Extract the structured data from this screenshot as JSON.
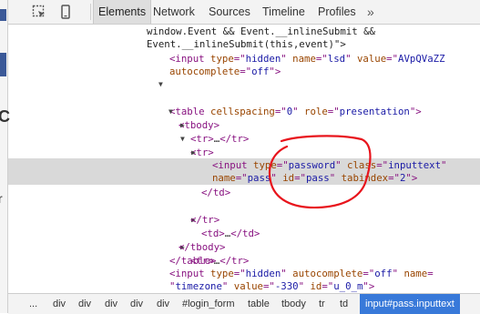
{
  "toolbar": {
    "inspect_icon": "inspect-element-icon",
    "device_icon": "device-mode-icon",
    "tabs": [
      {
        "label": "Elements"
      },
      {
        "label": "Network"
      },
      {
        "label": "Sources"
      },
      {
        "label": "Timeline"
      },
      {
        "label": "Profiles"
      }
    ],
    "more_label": "»"
  },
  "page_sliver": {
    "glyph_a": "C",
    "glyph_b": "r"
  },
  "dom_lines": [
    {
      "segments": [
        {
          "c": "plain",
          "t": "window.Event && Event.__inlineSubmit &&"
        }
      ]
    },
    {
      "segments": [
        {
          "c": "plain",
          "t": "Event.__inlineSubmit(this,event)\">"
        }
      ]
    },
    {
      "segments": [
        {
          "c": "tag",
          "t": "<input "
        },
        {
          "c": "attr",
          "t": "type"
        },
        {
          "c": "tag",
          "t": "=\""
        },
        {
          "c": "val",
          "t": "hidden"
        },
        {
          "c": "tag",
          "t": "\" "
        },
        {
          "c": "attr",
          "t": "name"
        },
        {
          "c": "tag",
          "t": "=\""
        },
        {
          "c": "val",
          "t": "lsd"
        },
        {
          "c": "tag",
          "t": "\" "
        },
        {
          "c": "attr",
          "t": "value"
        },
        {
          "c": "tag",
          "t": "=\""
        },
        {
          "c": "val",
          "t": "AVpQVaZZ"
        }
      ]
    },
    {
      "segments": [
        {
          "c": "attr",
          "t": "autocomplete"
        },
        {
          "c": "tag",
          "t": "=\""
        },
        {
          "c": "val",
          "t": "off"
        },
        {
          "c": "tag",
          "t": "\">"
        }
      ]
    },
    {
      "segments": [
        {
          "c": "tag",
          "t": "<table "
        },
        {
          "c": "attr",
          "t": "cellspacing"
        },
        {
          "c": "tag",
          "t": "=\""
        },
        {
          "c": "val",
          "t": "0"
        },
        {
          "c": "tag",
          "t": "\" "
        },
        {
          "c": "attr",
          "t": "role"
        },
        {
          "c": "tag",
          "t": "=\""
        },
        {
          "c": "val",
          "t": "presentation"
        },
        {
          "c": "tag",
          "t": "\">"
        }
      ]
    },
    {
      "segments": [
        {
          "c": "tag",
          "t": "<tbody>"
        }
      ]
    },
    {
      "segments": [
        {
          "c": "tag",
          "t": "<tr>"
        },
        {
          "c": "txt",
          "t": "…"
        },
        {
          "c": "tag",
          "t": "</tr>"
        }
      ]
    },
    {
      "segments": [
        {
          "c": "tag",
          "t": "<tr>"
        }
      ]
    },
    {
      "segments": [
        {
          "c": "tag",
          "t": "<td>"
        },
        {
          "c": "txt",
          "t": "…"
        },
        {
          "c": "tag",
          "t": "</td>"
        }
      ]
    },
    {
      "segments": [
        {
          "c": "tag",
          "t": "<td>"
        }
      ]
    },
    {
      "segments": [
        {
          "c": "tag",
          "t": "<input "
        },
        {
          "c": "attr",
          "t": "type"
        },
        {
          "c": "tag",
          "t": "=\""
        },
        {
          "c": "val",
          "t": "password"
        },
        {
          "c": "tag",
          "t": "\" "
        },
        {
          "c": "attr",
          "t": "class"
        },
        {
          "c": "tag",
          "t": "=\""
        },
        {
          "c": "val",
          "t": "inputtext"
        },
        {
          "c": "tag",
          "t": "\""
        }
      ]
    },
    {
      "segments": [
        {
          "c": "attr",
          "t": "name"
        },
        {
          "c": "tag",
          "t": "=\""
        },
        {
          "c": "val",
          "t": "pass"
        },
        {
          "c": "tag",
          "t": "\" "
        },
        {
          "c": "attr",
          "t": "id"
        },
        {
          "c": "tag",
          "t": "=\""
        },
        {
          "c": "val",
          "t": "pass"
        },
        {
          "c": "tag",
          "t": "\" "
        },
        {
          "c": "attr",
          "t": "tabindex"
        },
        {
          "c": "tag",
          "t": "=\""
        },
        {
          "c": "val",
          "t": "2"
        },
        {
          "c": "tag",
          "t": "\">"
        }
      ]
    },
    {
      "segments": [
        {
          "c": "tag",
          "t": "</td>"
        }
      ]
    },
    {
      "segments": [
        {
          "c": "tag",
          "t": "<td>"
        },
        {
          "c": "txt",
          "t": "…"
        },
        {
          "c": "tag",
          "t": "</td>"
        }
      ]
    },
    {
      "segments": [
        {
          "c": "tag",
          "t": "</tr>"
        }
      ]
    },
    {
      "segments": [
        {
          "c": "tag",
          "t": "<tr>"
        },
        {
          "c": "txt",
          "t": "…"
        },
        {
          "c": "tag",
          "t": "</tr>"
        }
      ]
    },
    {
      "segments": [
        {
          "c": "tag",
          "t": "</tbody>"
        }
      ]
    },
    {
      "segments": [
        {
          "c": "tag",
          "t": "</table>"
        }
      ]
    },
    {
      "segments": [
        {
          "c": "tag",
          "t": "<input "
        },
        {
          "c": "attr",
          "t": "type"
        },
        {
          "c": "tag",
          "t": "=\""
        },
        {
          "c": "val",
          "t": "hidden"
        },
        {
          "c": "tag",
          "t": "\" "
        },
        {
          "c": "attr",
          "t": "autocomplete"
        },
        {
          "c": "tag",
          "t": "=\""
        },
        {
          "c": "val",
          "t": "off"
        },
        {
          "c": "tag",
          "t": "\" "
        },
        {
          "c": "attr",
          "t": "name"
        },
        {
          "c": "tag",
          "t": "="
        }
      ]
    },
    {
      "segments": [
        {
          "c": "tag",
          "t": "\""
        },
        {
          "c": "val",
          "t": "timezone"
        },
        {
          "c": "tag",
          "t": "\" "
        },
        {
          "c": "attr",
          "t": "value"
        },
        {
          "c": "tag",
          "t": "=\""
        },
        {
          "c": "val",
          "t": "-330"
        },
        {
          "c": "tag",
          "t": "\" "
        },
        {
          "c": "attr",
          "t": "id"
        },
        {
          "c": "tag",
          "t": "=\""
        },
        {
          "c": "val",
          "t": "u_0_m"
        },
        {
          "c": "tag",
          "t": "\">"
        }
      ]
    }
  ],
  "breadcrumbs": {
    "items": [
      "...",
      "div",
      "div",
      "div",
      "div",
      "div",
      "#login_form",
      "table",
      "tbody",
      "tr",
      "td"
    ],
    "active": "input#pass.inputtext"
  },
  "colors": {
    "tag": "#881280",
    "attr": "#994500",
    "value": "#1a1aa6",
    "selection": "#d9d9d9",
    "breadcrumb_active": "#3879d9",
    "annotation": "#e8141c"
  }
}
